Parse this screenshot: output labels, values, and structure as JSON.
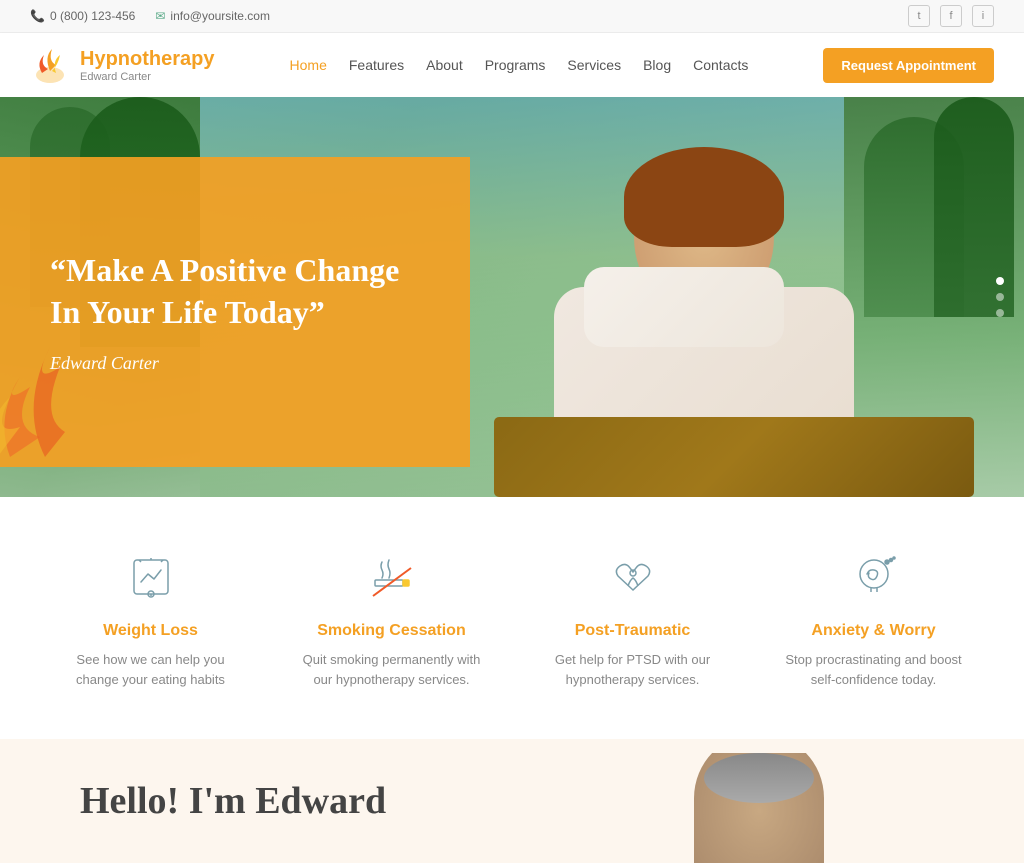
{
  "topbar": {
    "phone": "0 (800) 123-456",
    "email": "info@yoursite.com",
    "phone_icon": "📞",
    "email_icon": "✉",
    "social": [
      "t",
      "f",
      "i"
    ]
  },
  "header": {
    "logo_title": "Hypnotherapy",
    "logo_subtitle": "Edward Carter",
    "nav_links": [
      {
        "label": "Home",
        "active": true
      },
      {
        "label": "Features",
        "active": false
      },
      {
        "label": "About",
        "active": false
      },
      {
        "label": "Programs",
        "active": false
      },
      {
        "label": "Services",
        "active": false
      },
      {
        "label": "Blog",
        "active": false
      },
      {
        "label": "Contacts",
        "active": false
      }
    ],
    "cta_button": "Request Appointment"
  },
  "hero": {
    "quote": "“Make A Positive Change In Your Life Today”",
    "author": "Edward Carter",
    "dots": 3
  },
  "services": [
    {
      "id": "weight-loss",
      "title": "Weight Loss",
      "description": "See how we can help you change your eating habits",
      "icon": "scale"
    },
    {
      "id": "smoking-cessation",
      "title": "Smoking Cessation",
      "description": "Quit smoking permanently with our hypnotherapy services.",
      "icon": "no-smoking"
    },
    {
      "id": "post-traumatic",
      "title": "Post-Traumatic",
      "description": "Get help for PTSD with our hypnotherapy services.",
      "icon": "heart-person"
    },
    {
      "id": "anxiety-worry",
      "title": "Anxiety & Worry",
      "description": "Stop procrastinating and boost self-confidence today.",
      "icon": "head"
    }
  ],
  "hello": {
    "title": "Hello! I'm Edward"
  }
}
